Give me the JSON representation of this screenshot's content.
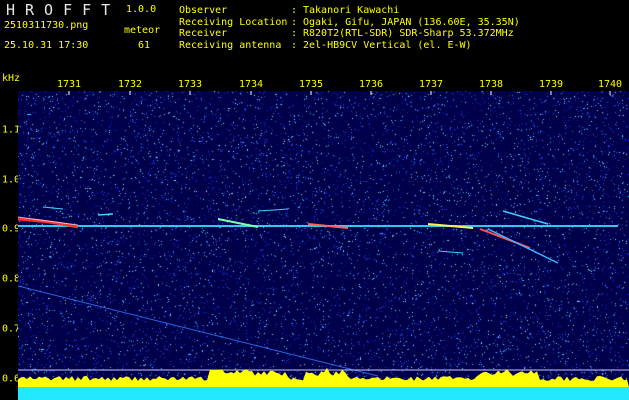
{
  "header": {
    "app_title": "HROFFT",
    "version": "1.0.0",
    "file_name": "2510311730.png",
    "timestamp": "25.10.31 17:30",
    "meteor_label": "meteor",
    "meteor_count": "61"
  },
  "station_info": [
    {
      "key": "Observer",
      "colon": ":",
      "value": "Takanori Kawachi"
    },
    {
      "key": "Receiving Location",
      "colon": ":",
      "value": "Ogaki, Gifu, JAPAN (136.60E, 35.35N)"
    },
    {
      "key": "Receiver",
      "colon": ":",
      "value": "R820T2(RTL-SDR) SDR-Sharp 53.372MHz"
    },
    {
      "key": "Receiving antenna",
      "colon": ":",
      "value": "2el-HB9CV Vertical (el. E-W)"
    }
  ],
  "axes": {
    "y_unit": "kHz",
    "x_ticks": [
      "1731",
      "1732",
      "1733",
      "1734",
      "1735",
      "1736",
      "1737",
      "1738",
      "1739",
      "1740"
    ],
    "y_ticks": [
      "1.1",
      "1.0",
      "0.9",
      "0.8",
      "0.7",
      "0.6"
    ]
  },
  "colors": {
    "label": "#ffff00",
    "background": "#00004a",
    "carrier": "#33e0ff",
    "echo": "#ff3030",
    "level_fill": "#ffff00",
    "level_base": "#22e8ff"
  },
  "chart_data": {
    "type": "heatmap",
    "x": [
      "17:30",
      "17:31",
      "17:32",
      "17:33",
      "17:34",
      "17:35",
      "17:36",
      "17:37",
      "17:38",
      "17:39",
      "17:40"
    ],
    "y_range_khz": [
      0.58,
      1.2
    ],
    "carrier_khz": 0.905,
    "echoes": [
      {
        "x": "17:30.1",
        "y_khz": 0.915,
        "strength": "strong"
      },
      {
        "x": "17:35.1",
        "y_khz": 0.905,
        "strength": "strong"
      },
      {
        "x": "17:37.2",
        "y_khz": 0.905,
        "strength": "strong"
      },
      {
        "x": "17:38.2",
        "y_khz": 0.89,
        "strength": "medium"
      },
      {
        "x": "17:32.9",
        "y_khz": 0.915,
        "strength": "weak"
      }
    ]
  }
}
